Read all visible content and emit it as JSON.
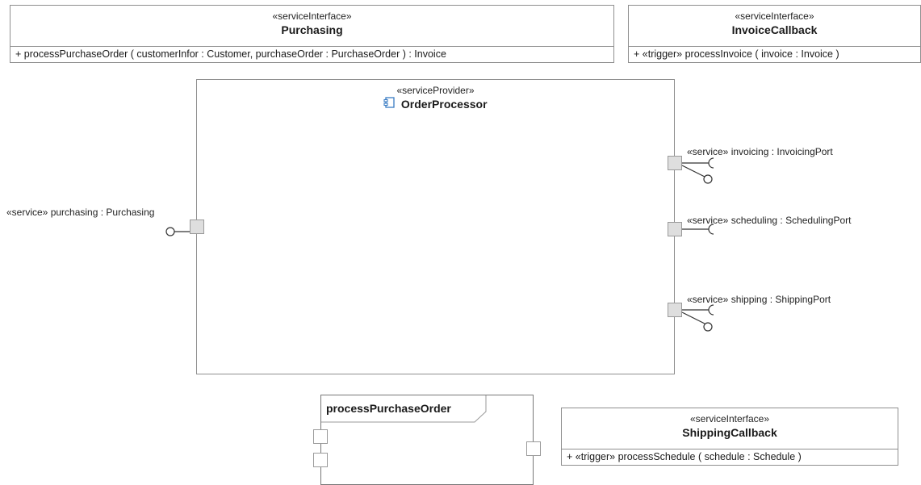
{
  "purchasing_interface": {
    "stereotype": "«serviceInterface»",
    "name": "Purchasing",
    "operation": "+ processPurchaseOrder ( customerInfor : Customer, purchaseOrder : PurchaseOrder ) : Invoice"
  },
  "invoice_callback_interface": {
    "stereotype": "«serviceInterface»",
    "name": "InvoiceCallback",
    "operation": "+ «trigger» processInvoice ( invoice : Invoice )"
  },
  "order_processor": {
    "stereotype": "«serviceProvider»",
    "name": "OrderProcessor",
    "icon": "component-icon",
    "ports": {
      "purchasing": "«service» purchasing : Purchasing",
      "invoicing": "«service» invoicing : InvoicingPort",
      "scheduling": "«service» scheduling : SchedulingPort",
      "shipping": "«service» shipping : ShippingPort"
    }
  },
  "process_purchase_order": {
    "name": "processPurchaseOrder"
  },
  "shipping_callback_interface": {
    "stereotype": "«serviceInterface»",
    "name": "ShippingCallback",
    "operation": "+ «trigger» processSchedule ( schedule : Schedule )"
  },
  "colors": {
    "border": "#8f8f8f",
    "port_fill": "#dedede",
    "icon_blue": "#3a7cc4"
  }
}
